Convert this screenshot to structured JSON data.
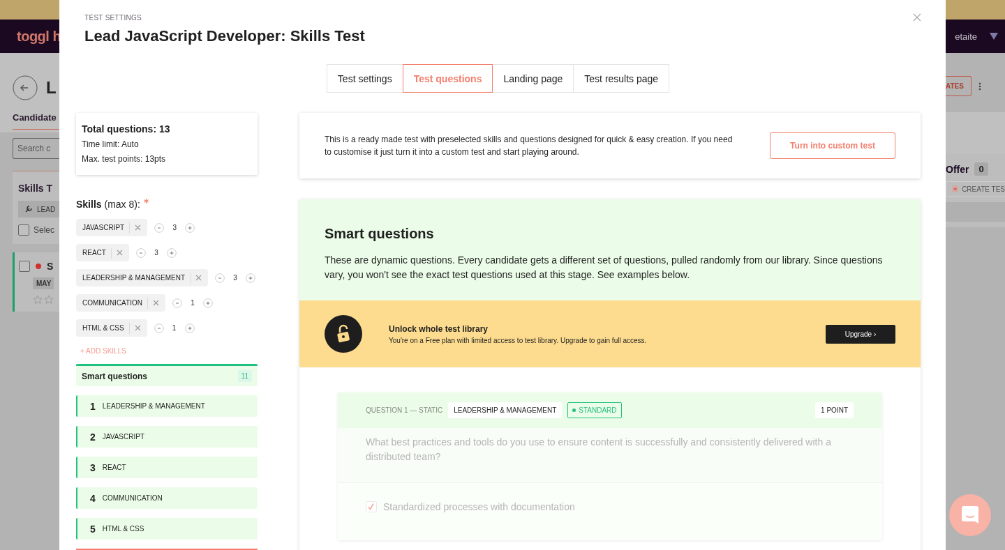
{
  "background_page": {
    "logo": "toggl h",
    "page_title": "L",
    "tab": "Candidate",
    "search": {
      "placeholder": "Search c"
    },
    "stage_card": {
      "title": "Skills T",
      "chip": "LEAD",
      "select_label": "Selec",
      "checked": false
    },
    "candidate_card": {
      "name": "S",
      "tag": "MAY",
      "checked": false,
      "color": "#d0312d"
    },
    "user_name": "etaite",
    "templates_button": "ATES",
    "offer_stage": {
      "title": "Offer",
      "count": "0",
      "create_button": "CREATE TES"
    }
  },
  "modal": {
    "eyebrow": "TEST SETTINGS",
    "title": "Lead JavaScript Developer: Skills Test",
    "tabs": [
      {
        "label": "Test settings",
        "selected": false
      },
      {
        "label": "Test questions",
        "selected": true
      },
      {
        "label": "Landing page",
        "selected": false
      },
      {
        "label": "Test results page",
        "selected": false
      }
    ],
    "summary": {
      "total": "Total questions: 13",
      "time_limit": "Time limit: Auto",
      "max_points": "Max. test points: 13pts"
    },
    "skills": {
      "label": "Skills",
      "hint": "(max 8):",
      "required": true,
      "items": [
        {
          "name": "JAVASCRIPT",
          "count": "3"
        },
        {
          "name": "REACT",
          "count": "3"
        },
        {
          "name": "LEADERSHIP & MANAGEMENT",
          "count": "3"
        },
        {
          "name": "COMMUNICATION",
          "count": "1"
        },
        {
          "name": "HTML & CSS",
          "count": "1"
        }
      ],
      "add_button": "+ ADD SKILLS"
    },
    "smart_questions": {
      "title": "Smart questions",
      "count": "11",
      "items": [
        {
          "number": "1",
          "skill": "LEADERSHIP & MANAGEMENT"
        },
        {
          "number": "2",
          "skill": "JAVASCRIPT"
        },
        {
          "number": "3",
          "skill": "REACT"
        },
        {
          "number": "4",
          "skill": "COMMUNICATION"
        },
        {
          "number": "5",
          "skill": "HTML & CSS"
        }
      ]
    },
    "notice": {
      "text": "This is a ready made test with preselected skills and questions designed for quick & easy creation. If you need to customise it just turn it into a custom test and start playing around.",
      "button": "Turn into custom test"
    },
    "smart_panel": {
      "title": "Smart questions",
      "description": "These are dynamic questions. Every candidate gets a different set of questions, pulled randomly from our library. Since questions vary, you won't see the exact test questions used at this stage. See examples below."
    },
    "upgrade_banner": {
      "title": "Unlock whole test library",
      "text": "You're on a Free plan with limited access to test library. Upgrade to gain full access.",
      "button": "Upgrade ›"
    },
    "question": {
      "label": "QUESTION 1 — STATIC",
      "skill": "LEADERSHIP & MANAGEMENT",
      "difficulty": "STANDARD",
      "points": "1 POINT",
      "text": "What best practices and tools do you use to ensure content is successfully and consistently delivered with a distributed team?",
      "answers": [
        {
          "text": "Standardized processes with documentation",
          "checked": true
        }
      ]
    }
  }
}
